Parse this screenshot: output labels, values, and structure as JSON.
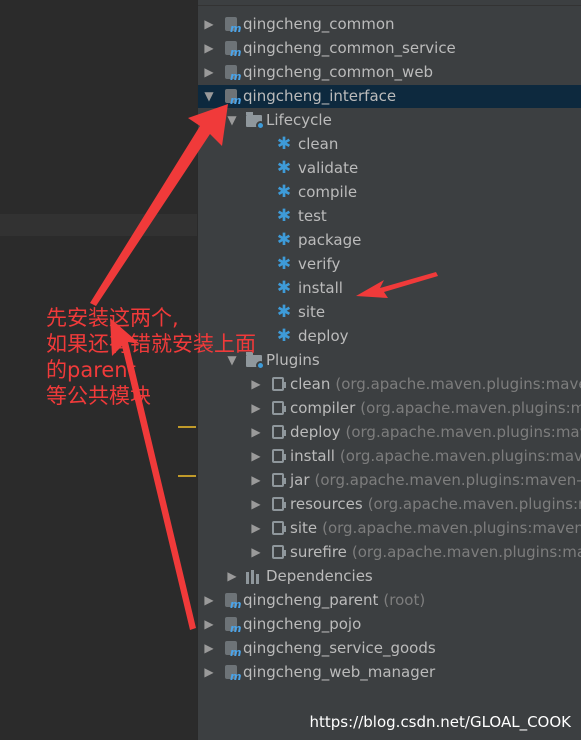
{
  "tree": {
    "modules_top": [
      {
        "label": "qingcheng_common",
        "expanded": false
      },
      {
        "label": "qingcheng_common_service",
        "expanded": false
      },
      {
        "label": "qingcheng_common_web",
        "expanded": false
      }
    ],
    "selected_module": {
      "label": "qingcheng_interface",
      "expanded": true
    },
    "lifecycle": {
      "label": "Lifecycle",
      "phases": [
        "clean",
        "validate",
        "compile",
        "test",
        "package",
        "verify",
        "install",
        "site",
        "deploy"
      ]
    },
    "plugins": {
      "label": "Plugins",
      "items": [
        {
          "name": "clean",
          "detail": "(org.apache.maven.plugins:maven-clean"
        },
        {
          "name": "compiler",
          "detail": "(org.apache.maven.plugins:maven-com"
        },
        {
          "name": "deploy",
          "detail": "(org.apache.maven.plugins:maven-deplo"
        },
        {
          "name": "install",
          "detail": "(org.apache.maven.plugins:maven-insta"
        },
        {
          "name": "jar",
          "detail": "(org.apache.maven.plugins:maven-jar-plug"
        },
        {
          "name": "resources",
          "detail": "(org.apache.maven.plugins:maven-reso"
        },
        {
          "name": "site",
          "detail": "(org.apache.maven.plugins:maven-site-plu"
        },
        {
          "name": "surefire",
          "detail": "(org.apache.maven.plugins:maven-sure"
        }
      ]
    },
    "dependencies": {
      "label": "Dependencies"
    },
    "modules_bottom": [
      {
        "label": "qingcheng_parent",
        "detail": "(root)"
      },
      {
        "label": "qingcheng_pojo",
        "detail": ""
      },
      {
        "label": "qingcheng_service_goods",
        "detail": ""
      },
      {
        "label": "qingcheng_web_manager",
        "detail": ""
      }
    ]
  },
  "annotation": {
    "lines": [
      "先安装这两个,",
      "如果还有错就安装上面",
      "的parent",
      "等公共模块"
    ],
    "color": "#f03a3a"
  },
  "watermark": "https://blog.csdn.net/GLOAL_COOK",
  "colors": {
    "selection": "#0d293e",
    "panel": "#3c3f41",
    "editor": "#2b2b2b",
    "gear": "#3e9bd8"
  }
}
